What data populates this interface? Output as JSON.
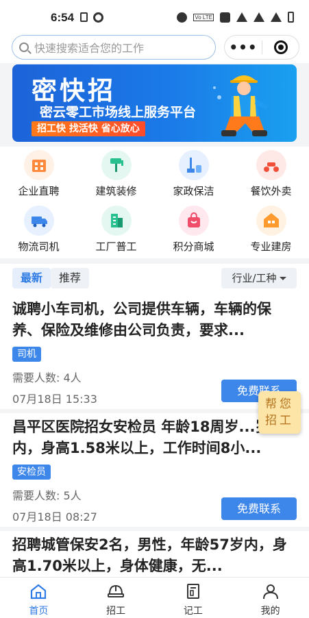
{
  "status": {
    "time": "6:54"
  },
  "search": {
    "placeholder": "快速搜索适合您的工作"
  },
  "capsule": {
    "more": "•••"
  },
  "banner": {
    "title": "密快招",
    "subtitle": "密云零工市场线上服务平台",
    "slogan": "招工快 找活快 省心放心"
  },
  "categories": [
    {
      "label": "企业直聘",
      "icon": "building-icon",
      "color": "#ff8a3d"
    },
    {
      "label": "建筑装修",
      "icon": "paint-roller-icon",
      "color": "#28c08f"
    },
    {
      "label": "家政保洁",
      "icon": "cleaning-icon",
      "color": "#3d86ea"
    },
    {
      "label": "餐饮外卖",
      "icon": "scooter-icon",
      "color": "#f0503a"
    },
    {
      "label": "物流司机",
      "icon": "truck-icon",
      "color": "#3d86ea"
    },
    {
      "label": "工厂普工",
      "icon": "factory-icon",
      "color": "#28c08f"
    },
    {
      "label": "积分商城",
      "icon": "shopping-bag-icon",
      "color": "#f04d6a"
    },
    {
      "label": "专业建房",
      "icon": "house-icon",
      "color": "#ff9a2f"
    }
  ],
  "tabs": {
    "latest": "最新",
    "recommend": "推荐",
    "filter": "行业/工种"
  },
  "jobs": [
    {
      "title": "诚聘小车司机，公司提供车辆，车辆的保养、保险及维修由公司负责，要求...",
      "tag": "司机",
      "count": "需要人数: 4人",
      "date": "07月18日 15:33",
      "button": "免费联系"
    },
    {
      "title": "昌平区医院招女安检员 年龄18周岁...岁内，身高1.58米以上，工作时间8小...",
      "tag": "安检员",
      "count": "需要人数: 5人",
      "date": "07月18日 08:27",
      "button": "免费联系"
    },
    {
      "title": "招聘城管保安2名，男性，年龄57岁内，身高1.70米以上，身体健康，无...",
      "tag": "",
      "count": "",
      "date": "",
      "button": ""
    }
  ],
  "float_help": {
    "line1": "帮您",
    "line2": "招工"
  },
  "tabbar": [
    {
      "label": "首页",
      "icon": "home-icon",
      "active": true
    },
    {
      "label": "招工",
      "icon": "helmet-icon",
      "active": false
    },
    {
      "label": "记工",
      "icon": "notebook-icon",
      "active": false
    },
    {
      "label": "我的",
      "icon": "user-icon",
      "active": false
    }
  ]
}
